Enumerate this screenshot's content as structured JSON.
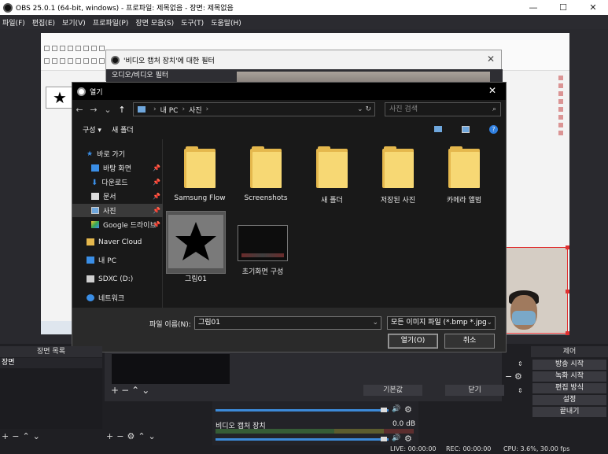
{
  "window": {
    "title": "OBS 25.0.1 (64-bit, windows) - 프로파일: 제목없음 - 장면: 제목없음"
  },
  "menu": [
    "파일(F)",
    "편집(E)",
    "보기(V)",
    "프로파일(P)",
    "장면 모음(S)",
    "도구(T)",
    "도움말(H)"
  ],
  "filter_dialog": {
    "title": "'비디오 캡처 장치'에 대한 필터",
    "section": "오디오/비디오 필터"
  },
  "file_dialog": {
    "title": "열기",
    "path": [
      "내 PC",
      "사진"
    ],
    "search_placeholder": "사진 검색",
    "organize": "구성 ▾",
    "new_folder": "새 폴더",
    "sidebar": [
      {
        "label": "바로 가기",
        "icon": "star-icon"
      },
      {
        "label": "바탕 화면",
        "icon": "desktop-icon"
      },
      {
        "label": "다운로드",
        "icon": "download-icon"
      },
      {
        "label": "문서",
        "icon": "document-icon"
      },
      {
        "label": "사진",
        "icon": "pictures-icon"
      },
      {
        "label": "Google 드라이브",
        "icon": "google-drive-icon"
      },
      {
        "label": "Naver Cloud",
        "icon": "folder-icon"
      },
      {
        "label": "내 PC",
        "icon": "pc-icon"
      },
      {
        "label": "SDXC (D:)",
        "icon": "drive-icon"
      },
      {
        "label": "네트워크",
        "icon": "network-icon"
      }
    ],
    "files": [
      {
        "label": "Samsung Flow",
        "kind": "folder"
      },
      {
        "label": "Screenshots",
        "kind": "folder"
      },
      {
        "label": "새 폴더",
        "kind": "folder"
      },
      {
        "label": "저장된 사진",
        "kind": "folder"
      },
      {
        "label": "카메라 앨범",
        "kind": "folder"
      },
      {
        "label": "그림01",
        "kind": "image-star"
      },
      {
        "label": "초기화면 구성",
        "kind": "image-screen"
      }
    ],
    "filename_label": "파일 이름(N):",
    "filename_value": "그림01",
    "filetype": "모든 이미지 파일 (*.bmp *.jpg",
    "open_button": "열기(O)",
    "cancel_button": "취소"
  },
  "obs": {
    "scenes_header": "장면 목록",
    "scene_item": "장면",
    "default_button": "기본값",
    "close_button": "닫기",
    "mixer": {
      "source_name": "비디오 캡처 장치",
      "db": "0.0 dB"
    },
    "controls_header": "제어",
    "controls": [
      "방송 시작",
      "녹화 시작",
      "편집 방식",
      "설정",
      "끝내기"
    ],
    "status": {
      "live": "LIVE: 00:00:00",
      "rec": "REC: 00:00:00",
      "cpu": "CPU: 3.6%, 30.00 fps"
    }
  }
}
